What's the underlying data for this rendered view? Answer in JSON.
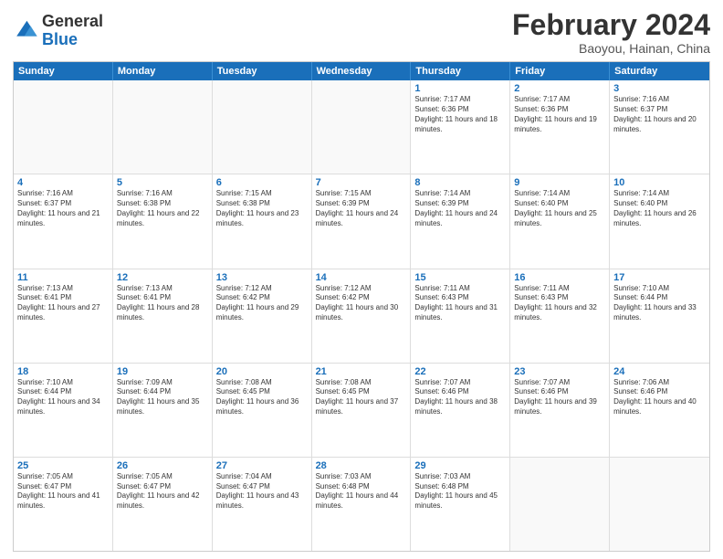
{
  "header": {
    "logo_general": "General",
    "logo_blue": "Blue",
    "month_year": "February 2024",
    "location": "Baoyou, Hainan, China"
  },
  "weekdays": [
    "Sunday",
    "Monday",
    "Tuesday",
    "Wednesday",
    "Thursday",
    "Friday",
    "Saturday"
  ],
  "rows": [
    [
      {
        "day": "",
        "info": ""
      },
      {
        "day": "",
        "info": ""
      },
      {
        "day": "",
        "info": ""
      },
      {
        "day": "",
        "info": ""
      },
      {
        "day": "1",
        "info": "Sunrise: 7:17 AM\nSunset: 6:36 PM\nDaylight: 11 hours and 18 minutes."
      },
      {
        "day": "2",
        "info": "Sunrise: 7:17 AM\nSunset: 6:36 PM\nDaylight: 11 hours and 19 minutes."
      },
      {
        "day": "3",
        "info": "Sunrise: 7:16 AM\nSunset: 6:37 PM\nDaylight: 11 hours and 20 minutes."
      }
    ],
    [
      {
        "day": "4",
        "info": "Sunrise: 7:16 AM\nSunset: 6:37 PM\nDaylight: 11 hours and 21 minutes."
      },
      {
        "day": "5",
        "info": "Sunrise: 7:16 AM\nSunset: 6:38 PM\nDaylight: 11 hours and 22 minutes."
      },
      {
        "day": "6",
        "info": "Sunrise: 7:15 AM\nSunset: 6:38 PM\nDaylight: 11 hours and 23 minutes."
      },
      {
        "day": "7",
        "info": "Sunrise: 7:15 AM\nSunset: 6:39 PM\nDaylight: 11 hours and 24 minutes."
      },
      {
        "day": "8",
        "info": "Sunrise: 7:14 AM\nSunset: 6:39 PM\nDaylight: 11 hours and 24 minutes."
      },
      {
        "day": "9",
        "info": "Sunrise: 7:14 AM\nSunset: 6:40 PM\nDaylight: 11 hours and 25 minutes."
      },
      {
        "day": "10",
        "info": "Sunrise: 7:14 AM\nSunset: 6:40 PM\nDaylight: 11 hours and 26 minutes."
      }
    ],
    [
      {
        "day": "11",
        "info": "Sunrise: 7:13 AM\nSunset: 6:41 PM\nDaylight: 11 hours and 27 minutes."
      },
      {
        "day": "12",
        "info": "Sunrise: 7:13 AM\nSunset: 6:41 PM\nDaylight: 11 hours and 28 minutes."
      },
      {
        "day": "13",
        "info": "Sunrise: 7:12 AM\nSunset: 6:42 PM\nDaylight: 11 hours and 29 minutes."
      },
      {
        "day": "14",
        "info": "Sunrise: 7:12 AM\nSunset: 6:42 PM\nDaylight: 11 hours and 30 minutes."
      },
      {
        "day": "15",
        "info": "Sunrise: 7:11 AM\nSunset: 6:43 PM\nDaylight: 11 hours and 31 minutes."
      },
      {
        "day": "16",
        "info": "Sunrise: 7:11 AM\nSunset: 6:43 PM\nDaylight: 11 hours and 32 minutes."
      },
      {
        "day": "17",
        "info": "Sunrise: 7:10 AM\nSunset: 6:44 PM\nDaylight: 11 hours and 33 minutes."
      }
    ],
    [
      {
        "day": "18",
        "info": "Sunrise: 7:10 AM\nSunset: 6:44 PM\nDaylight: 11 hours and 34 minutes."
      },
      {
        "day": "19",
        "info": "Sunrise: 7:09 AM\nSunset: 6:44 PM\nDaylight: 11 hours and 35 minutes."
      },
      {
        "day": "20",
        "info": "Sunrise: 7:08 AM\nSunset: 6:45 PM\nDaylight: 11 hours and 36 minutes."
      },
      {
        "day": "21",
        "info": "Sunrise: 7:08 AM\nSunset: 6:45 PM\nDaylight: 11 hours and 37 minutes."
      },
      {
        "day": "22",
        "info": "Sunrise: 7:07 AM\nSunset: 6:46 PM\nDaylight: 11 hours and 38 minutes."
      },
      {
        "day": "23",
        "info": "Sunrise: 7:07 AM\nSunset: 6:46 PM\nDaylight: 11 hours and 39 minutes."
      },
      {
        "day": "24",
        "info": "Sunrise: 7:06 AM\nSunset: 6:46 PM\nDaylight: 11 hours and 40 minutes."
      }
    ],
    [
      {
        "day": "25",
        "info": "Sunrise: 7:05 AM\nSunset: 6:47 PM\nDaylight: 11 hours and 41 minutes."
      },
      {
        "day": "26",
        "info": "Sunrise: 7:05 AM\nSunset: 6:47 PM\nDaylight: 11 hours and 42 minutes."
      },
      {
        "day": "27",
        "info": "Sunrise: 7:04 AM\nSunset: 6:47 PM\nDaylight: 11 hours and 43 minutes."
      },
      {
        "day": "28",
        "info": "Sunrise: 7:03 AM\nSunset: 6:48 PM\nDaylight: 11 hours and 44 minutes."
      },
      {
        "day": "29",
        "info": "Sunrise: 7:03 AM\nSunset: 6:48 PM\nDaylight: 11 hours and 45 minutes."
      },
      {
        "day": "",
        "info": ""
      },
      {
        "day": "",
        "info": ""
      }
    ]
  ]
}
